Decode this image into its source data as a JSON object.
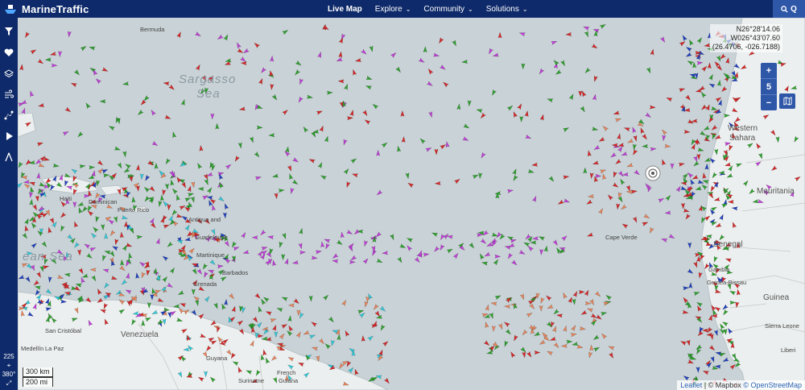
{
  "brand": {
    "name": "MarineTraffic"
  },
  "nav": [
    {
      "label": "Live Map",
      "active": true
    },
    {
      "label": "Explore"
    },
    {
      "label": "Community"
    },
    {
      "label": "Solutions"
    }
  ],
  "search": {
    "label": "Q"
  },
  "sidebar": {
    "icons": [
      "filter-icon",
      "heart-icon",
      "layers-icon",
      "wind-icon",
      "route-icon",
      "play-icon",
      "measure-icon"
    ],
    "bottom": {
      "zoom_value": "225",
      "extent_label": "380°"
    }
  },
  "coords": {
    "lat": "N26°28'14.06",
    "lon": "W026°43'07.60",
    "decimal": "(26.4706, -026.7188)"
  },
  "zoom": {
    "plus": "+",
    "level": "5",
    "minus": "−"
  },
  "scale": {
    "km": "300 km",
    "mi": "200 mi"
  },
  "attribution": {
    "leaflet": "Leaflet",
    "mapbox": "© Mapbox",
    "osm": "© OpenStreetMap"
  },
  "map_labels": {
    "sargasso_1": "Sargasso",
    "sargasso_2": "Sea",
    "caribbean": "ean Sea",
    "western_sahara_1": "Western",
    "western_sahara_2": "Sahara",
    "mauritania": "Mauritania",
    "senegal": "Senegal",
    "guinea": "Guinea",
    "sierra_leone": "Sierra Leone",
    "liberia": "Liberi",
    "guinea_bissau": "Guinea-Bissau",
    "gambia": "Gambia",
    "cape_verde": "Cape Verde",
    "venezuela": "Venezuela",
    "guyana": "Guyana",
    "suriname": "Suriname",
    "french_guiana_1": "French",
    "french_guiana_2": "Guiana",
    "haiti": "Haiti",
    "dominican": "Dominican",
    "puerto_rico": "Puerto Rico",
    "antigua": "Antigua and",
    "guadeloupe": "Guadeloupe",
    "martinique": "Martinique",
    "barbados": "Barbados",
    "grenada": "Grenada",
    "bermuda": "Bermuda",
    "san_cristobal": "San Cristóbal",
    "medellin": "Medellín",
    "la_paz": "La Paz"
  },
  "colors": {
    "cargo": "#2ca02c",
    "tanker": "#d62728",
    "passenger": "#1f3fbf",
    "pleasure": "#c03fd8",
    "fishing": "#e8845a",
    "tug": "#2fc8d8",
    "sea": "#c9d2d6",
    "land": "#ecefef",
    "topbar": "#0e2a6a"
  }
}
